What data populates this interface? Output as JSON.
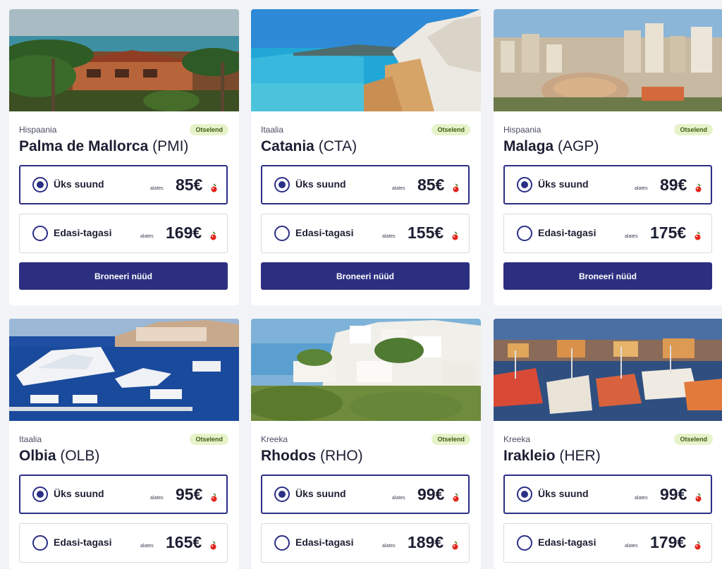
{
  "badge_label": "Otselend",
  "from_label": "alates",
  "one_way_label": "Üks suund",
  "round_trip_label": "Edasi-tagasi",
  "book_label": "Broneeri nüüd",
  "colors": {
    "brand": "#2c2f80",
    "badge_bg": "#e6f3c9",
    "cherry": "#e2261c"
  },
  "cards": [
    {
      "country": "Hispaania",
      "city": "Palma de Mallorca",
      "code": "(PMI)",
      "one_way_price": "85€",
      "round_trip_price": "169€",
      "image": "palm-villa-sea-photo"
    },
    {
      "country": "Itaalia",
      "city": "Catania",
      "code": "(CTA)",
      "one_way_price": "85€",
      "round_trip_price": "155€",
      "image": "white-cliff-beach-photo"
    },
    {
      "country": "Hispaania",
      "city": "Malaga",
      "code": "(AGP)",
      "one_way_price": "89€",
      "round_trip_price": "175€",
      "image": "bullring-city-photo"
    },
    {
      "country": "Itaalia",
      "city": "Olbia",
      "code": "(OLB)",
      "one_way_price": "95€",
      "round_trip_price": "165€",
      "image": "yacht-marina-photo"
    },
    {
      "country": "Kreeka",
      "city": "Rhodos",
      "code": "(RHO)",
      "one_way_price": "99€",
      "round_trip_price": "189€",
      "image": "white-village-hill-photo"
    },
    {
      "country": "Kreeka",
      "city": "Irakleio",
      "code": "(HER)",
      "one_way_price": "99€",
      "round_trip_price": "179€",
      "image": "harbor-boats-sunset-photo"
    }
  ]
}
